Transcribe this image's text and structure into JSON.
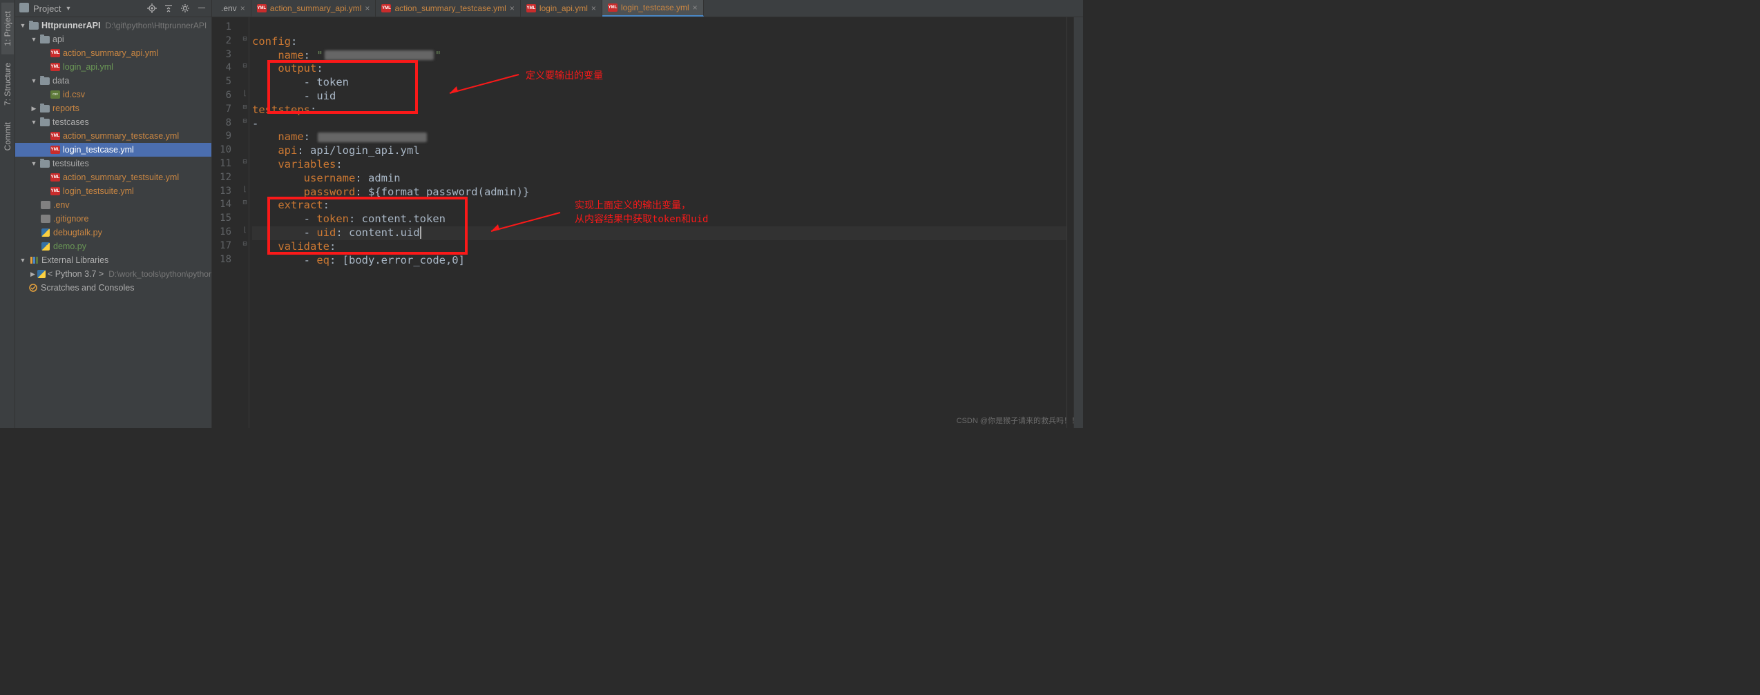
{
  "left_tabs": {
    "project": "1: Project",
    "structure": "7: Structure",
    "commit": "Commit"
  },
  "project": {
    "title": "Project",
    "root": {
      "name": "HttprunnerAPI",
      "path": "D:\\git\\python\\HttprunnerAPI"
    },
    "tree": {
      "api": "api",
      "api_files": [
        "action_summary_api.yml",
        "login_api.yml"
      ],
      "data": "data",
      "data_files": [
        "id.csv"
      ],
      "reports": "reports",
      "testcases": "testcases",
      "testcases_files": [
        "action_summary_testcase.yml",
        "login_testcase.yml"
      ],
      "testsuites": "testsuites",
      "testsuites_files": [
        "action_summary_testsuite.yml",
        "login_testsuite.yml"
      ],
      "env": ".env",
      "gitignore": ".gitignore",
      "debugtalk": "debugtalk.py",
      "demo": "demo.py"
    },
    "external": "External Libraries",
    "python": {
      "label": "< Python 3.7 >",
      "path": "D:\\work_tools\\python\\python.exe"
    },
    "scratches": "Scratches and Consoles"
  },
  "tabs": [
    {
      "label": ".env",
      "type": "env"
    },
    {
      "label": "action_summary_api.yml",
      "type": "yml",
      "orange": true
    },
    {
      "label": "action_summary_testcase.yml",
      "type": "yml",
      "orange": true
    },
    {
      "label": "login_api.yml",
      "type": "yml",
      "orange": true
    },
    {
      "label": "login_testcase.yml",
      "type": "yml",
      "orange": true,
      "active": true
    }
  ],
  "code": {
    "l2": {
      "key": "config",
      "colon": ":"
    },
    "l3": {
      "key": "name",
      "colon": ": ",
      "q": "\""
    },
    "l4": {
      "key": "output",
      "colon": ":"
    },
    "l5": {
      "dash": "- ",
      "val": "token"
    },
    "l6": {
      "dash": "- ",
      "val": "uid"
    },
    "l7": {
      "key": "teststeps",
      "colon": ":"
    },
    "l8": {
      "dash": "-"
    },
    "l9": {
      "key": "name",
      "colon": ": "
    },
    "l10": {
      "key": "api",
      "colon": ": ",
      "val": "api/login_api.yml"
    },
    "l11": {
      "key": "variables",
      "colon": ":"
    },
    "l12": {
      "key": "username",
      "colon": ": ",
      "val": "admin"
    },
    "l13": {
      "key": "password",
      "colon": ": ",
      "val": "${format_password(admin)}"
    },
    "l14": {
      "key": "extract",
      "colon": ":"
    },
    "l15": {
      "dash": "- ",
      "key": "token",
      "colon": ": ",
      "val": "content.token"
    },
    "l16": {
      "dash": "- ",
      "key": "uid",
      "colon": ": ",
      "val": "content.uid"
    },
    "l17": {
      "key": "validate",
      "colon": ":"
    },
    "l18": {
      "dash": "- ",
      "key": "eq",
      "colon": ": ",
      "val": "[body.error_code,0]"
    }
  },
  "annotations": {
    "a1": "定义要输出的变量",
    "a2_l1": "实现上面定义的输出变量，",
    "a2_l2": "从内容结果中获取token和uid"
  },
  "watermark": "CSDN @你是猴子请来的救兵吗！！"
}
